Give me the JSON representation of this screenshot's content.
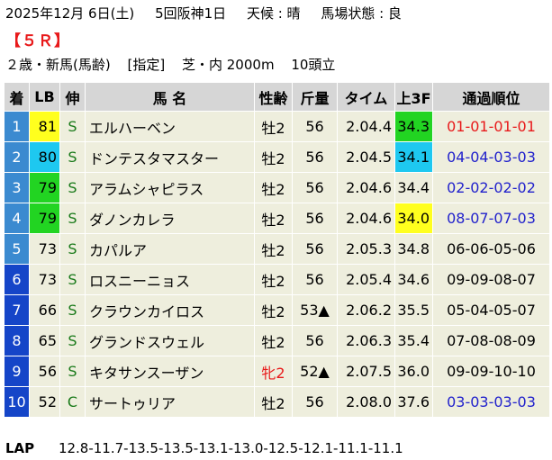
{
  "header": {
    "date": "2025年12月 6日(土)",
    "meeting": "5回阪神1日",
    "weather": "天候 : 晴",
    "track_condition": "馬場状態 : 良"
  },
  "race": {
    "number": "【５Ｒ】",
    "age_class": "２歳・新馬(馬齢)",
    "designation": "[指定]",
    "course": "芝・内 2000m",
    "field": "10頭立"
  },
  "table": {
    "headers": [
      "着",
      "LB",
      "伸",
      "馬 名",
      "性齢",
      "斤量",
      "タイム",
      "上3F",
      "通過順位"
    ],
    "rows": [
      {
        "pos": "1",
        "pos_bg": "#3b8ad0",
        "lb": "81",
        "lb_bg": "#ffff1e",
        "nobi": "S",
        "nobi_color": "#1a7a1a",
        "name": "エルハーベン",
        "sex_age": "牡2",
        "sex_color": "#000000",
        "weight": "56",
        "time": "2.04.4",
        "last3f": "34.3",
        "last3f_bg": "#22d422",
        "passing": "01-01-01-01",
        "passing_color": "#e8191a"
      },
      {
        "pos": "2",
        "pos_bg": "#3b8ad0",
        "lb": "80",
        "lb_bg": "#1ec8f0",
        "nobi": "S",
        "nobi_color": "#1a7a1a",
        "name": "ドンテスタマスター",
        "sex_age": "牡2",
        "sex_color": "#000000",
        "weight": "56",
        "time": "2.04.5",
        "last3f": "34.1",
        "last3f_bg": "#1ec8f0",
        "passing": "04-04-03-03",
        "passing_color": "#2222cc"
      },
      {
        "pos": "3",
        "pos_bg": "#3b8ad0",
        "lb": "79",
        "lb_bg": "#22d422",
        "nobi": "S",
        "nobi_color": "#1a7a1a",
        "name": "アラムシャピラス",
        "sex_age": "牡2",
        "sex_color": "#000000",
        "weight": "56",
        "time": "2.04.6",
        "last3f": "34.4",
        "last3f_bg": "",
        "passing": "02-02-02-02",
        "passing_color": "#2222cc"
      },
      {
        "pos": "4",
        "pos_bg": "#3b8ad0",
        "lb": "79",
        "lb_bg": "#22d422",
        "nobi": "S",
        "nobi_color": "#1a7a1a",
        "name": "ダノンカレラ",
        "sex_age": "牡2",
        "sex_color": "#000000",
        "weight": "56",
        "time": "2.04.6",
        "last3f": "34.0",
        "last3f_bg": "#ffff1e",
        "passing": "08-07-07-03",
        "passing_color": "#2222cc"
      },
      {
        "pos": "5",
        "pos_bg": "#3b8ad0",
        "lb": "73",
        "lb_bg": "",
        "nobi": "S",
        "nobi_color": "#1a7a1a",
        "name": "カパルア",
        "sex_age": "牡2",
        "sex_color": "#000000",
        "weight": "56",
        "time": "2.05.3",
        "last3f": "34.8",
        "last3f_bg": "",
        "passing": "06-06-05-06",
        "passing_color": "#000000"
      },
      {
        "pos": "6",
        "pos_bg": "#1545c8",
        "lb": "73",
        "lb_bg": "",
        "nobi": "S",
        "nobi_color": "#1a7a1a",
        "name": "ロスニーニョス",
        "sex_age": "牡2",
        "sex_color": "#000000",
        "weight": "56",
        "time": "2.05.4",
        "last3f": "34.6",
        "last3f_bg": "",
        "passing": "09-09-08-07",
        "passing_color": "#000000"
      },
      {
        "pos": "7",
        "pos_bg": "#1545c8",
        "lb": "66",
        "lb_bg": "",
        "nobi": "S",
        "nobi_color": "#1a7a1a",
        "name": "クラウンカイロス",
        "sex_age": "牡2",
        "sex_color": "#000000",
        "weight": "53▲",
        "time": "2.06.2",
        "last3f": "35.5",
        "last3f_bg": "",
        "passing": "05-04-05-07",
        "passing_color": "#000000"
      },
      {
        "pos": "8",
        "pos_bg": "#1545c8",
        "lb": "65",
        "lb_bg": "",
        "nobi": "S",
        "nobi_color": "#1a7a1a",
        "name": "グランドスウェル",
        "sex_age": "牡2",
        "sex_color": "#000000",
        "weight": "56",
        "time": "2.06.3",
        "last3f": "35.4",
        "last3f_bg": "",
        "passing": "07-08-08-09",
        "passing_color": "#000000"
      },
      {
        "pos": "9",
        "pos_bg": "#1545c8",
        "lb": "56",
        "lb_bg": "",
        "nobi": "S",
        "nobi_color": "#1a7a1a",
        "name": "キタサンスーザン",
        "sex_age": "牝2",
        "sex_color": "#e8191a",
        "weight": "52▲",
        "time": "2.07.5",
        "last3f": "36.0",
        "last3f_bg": "",
        "passing": "09-09-10-10",
        "passing_color": "#000000"
      },
      {
        "pos": "10",
        "pos_bg": "#1545c8",
        "lb": "52",
        "lb_bg": "",
        "nobi": "C",
        "nobi_color": "#1a7a1a",
        "name": "サートゥリア",
        "sex_age": "牡2",
        "sex_color": "#000000",
        "weight": "56",
        "time": "2.08.0",
        "last3f": "37.6",
        "last3f_bg": "",
        "passing": "03-03-03-03",
        "passing_color": "#2222cc"
      }
    ]
  },
  "lap": {
    "label": "LAP",
    "values": "12.8-11.7-13.5-13.5-13.1-13.0-12.5-12.1-11.1-11.1"
  }
}
